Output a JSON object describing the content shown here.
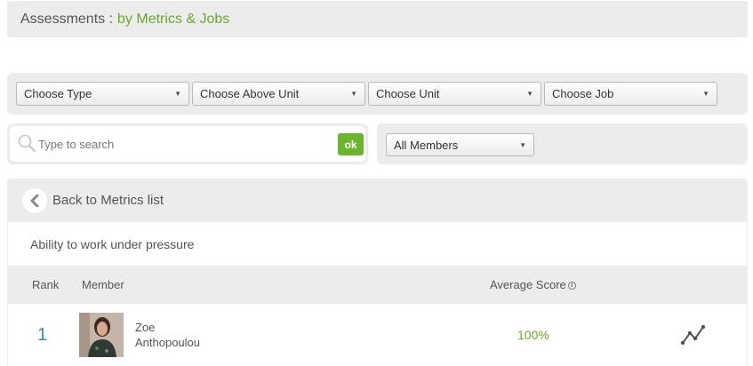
{
  "header": {
    "prefix": "Assessments :",
    "section": "by Metrics & Jobs"
  },
  "filters": {
    "type_label": "Choose Type",
    "above_unit_label": "Choose Above Unit",
    "unit_label": "Choose Unit",
    "job_label": "Choose Job"
  },
  "search": {
    "placeholder": "Type to search",
    "ok_label": "ok"
  },
  "members_filter": {
    "label": "All Members"
  },
  "panel": {
    "back_label": "Back to Metrics list",
    "metric_name": "Ability to work under pressure",
    "columns": {
      "rank": "Rank",
      "member": "Member",
      "average_score": "Average Score"
    },
    "rows": [
      {
        "rank": "1",
        "first_name": "Zoe",
        "last_name": "Anthopoulou",
        "score": "100%"
      }
    ]
  },
  "colors": {
    "accent_green": "#6aaa2a",
    "rank_blue": "#2f8fc9",
    "panel_gray": "#ececec"
  }
}
